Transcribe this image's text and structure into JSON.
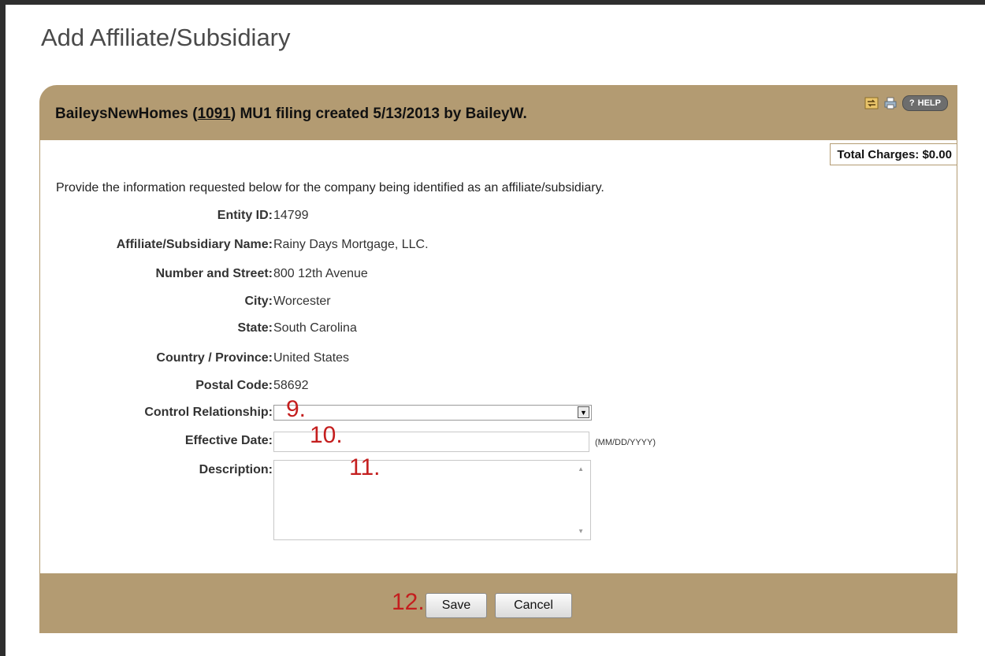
{
  "page": {
    "title": "Add Affiliate/Subsidiary"
  },
  "panel": {
    "header_prefix": "BaileysNewHomes (",
    "entity_number": "1091",
    "header_suffix": ") MU1 filing created 5/13/2013 by BaileyW.",
    "help_label": "HELP",
    "help_q": "?",
    "total_charges": "Total Charges: $0.00",
    "instructions": "Provide the information requested below for the company being identified as an affiliate/subsidiary."
  },
  "fields": [
    {
      "label": "Entity ID:",
      "value": "14799"
    },
    {
      "label": "Affiliate/Subsidiary Name:",
      "value": "Rainy Days Mortgage, LLC."
    },
    {
      "label": "Number and Street:",
      "value": "800 12th Avenue"
    },
    {
      "label": "City:",
      "value": "Worcester"
    },
    {
      "label": "State:",
      "value": "South Carolina"
    },
    {
      "label": "Country / Province:",
      "value": "United States"
    },
    {
      "label": "Postal Code:",
      "value": "58692"
    }
  ],
  "form": {
    "control_relationship_label": "Control Relationship:",
    "control_relationship_value": "",
    "effective_date_label": "Effective Date:",
    "effective_date_value": "",
    "date_format_hint": "(MM/DD/YYYY)",
    "description_label": "Description:",
    "description_value": ""
  },
  "annotations": {
    "a9": "9.",
    "a10": "10.",
    "a11": "11.",
    "a12": "12."
  },
  "footer": {
    "save_label": "Save",
    "cancel_label": "Cancel"
  },
  "icons": [
    "swap-icon",
    "print-icon",
    "help-icon"
  ],
  "colors": {
    "header_bg": "#b39b72",
    "annotation": "#c41e1e",
    "frame": "#2e2e2e"
  }
}
